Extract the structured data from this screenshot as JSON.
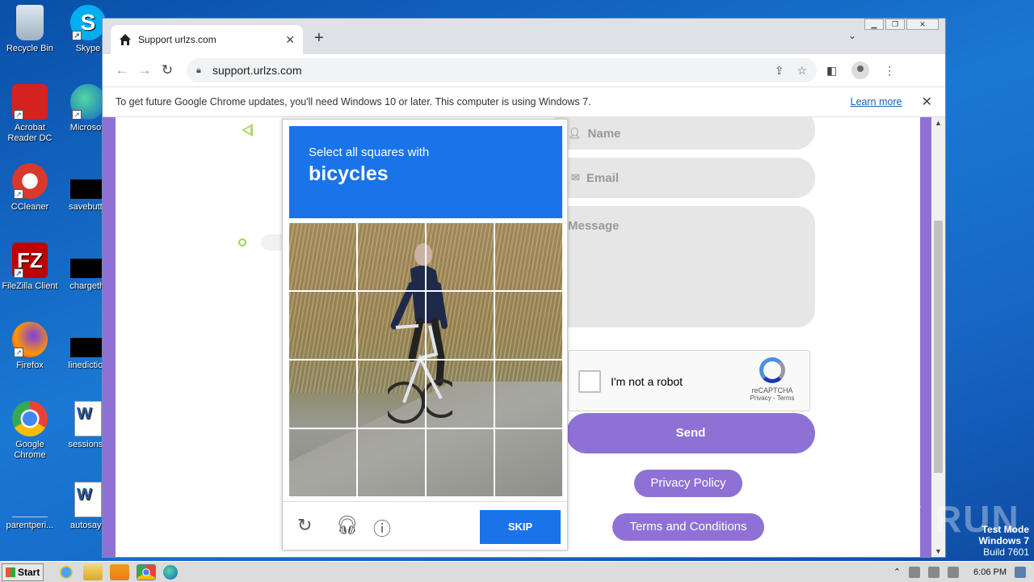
{
  "desktop": {
    "icons": [
      {
        "label": "Recycle Bin"
      },
      {
        "label": "Skype"
      },
      {
        "label": "Acrobat Reader DC"
      },
      {
        "label": "Microsoft"
      },
      {
        "label": "CCleaner"
      },
      {
        "label": "savebutto"
      },
      {
        "label": "FileZilla Client"
      },
      {
        "label": "chargethi"
      },
      {
        "label": "Firefox"
      },
      {
        "label": "linediction"
      },
      {
        "label": "Google Chrome"
      },
      {
        "label": "sessionsu"
      },
      {
        "label": "parentperi..."
      },
      {
        "label": "autosays"
      }
    ]
  },
  "browser": {
    "tab_title": "Support urlzs.com",
    "url": "support.urlzs.com",
    "infobar_text": "To get future Google Chrome updates, you'll need Windows 10 or later. This computer is using Windows 7.",
    "infobar_link": "Learn more"
  },
  "form": {
    "name_placeholder": "Name",
    "email_placeholder": "Email",
    "message_placeholder": "Message",
    "recaptcha_label": "I'm not a robot",
    "recaptcha_brand": "reCAPTCHA",
    "recaptcha_links": "Privacy - Terms",
    "send_label": "Send",
    "privacy_label": "Privacy Policy",
    "terms_label": "Terms and Conditions"
  },
  "challenge": {
    "instruction": "Select all squares with",
    "target": "bicycles",
    "skip_label": "SKIP"
  },
  "overlay": {
    "watermark": "ANY RUN",
    "test_mode": "Test Mode",
    "os": "Windows 7",
    "build": "Build 7601"
  },
  "taskbar": {
    "start_label": "Start",
    "clock": "6:06 PM"
  },
  "colors": {
    "accent_purple": "#8f71d6",
    "captcha_blue": "#1a73e8"
  }
}
